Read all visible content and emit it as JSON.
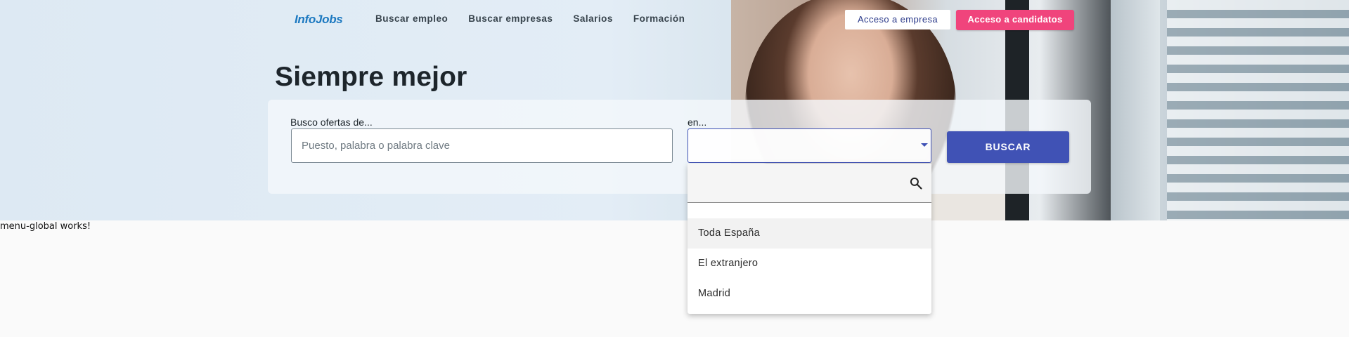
{
  "header": {
    "logo": "InfoJobs",
    "nav": [
      "Buscar empleo",
      "Buscar empresas",
      "Salarios",
      "Formación"
    ],
    "empresa_button": "Acceso a empresa",
    "candidatos_button": "Acceso a candidatos"
  },
  "hero": {
    "title": "Siempre mejor"
  },
  "search": {
    "keyword_label": "Busco ofertas de...",
    "keyword_placeholder": "Puesto, palabra o palabra clave",
    "location_label": "en...",
    "submit_label": "BUSCAR"
  },
  "location_dropdown": {
    "search_value": "",
    "options": [
      "Toda España",
      "El extranjero",
      "Madrid"
    ],
    "highlighted_option": "Toda España"
  },
  "footer_text": "menu-global works!",
  "colors": {
    "brand_blue": "#1b78c0",
    "accent_pink": "#f0447c",
    "primary_indigo": "#4052b5"
  }
}
